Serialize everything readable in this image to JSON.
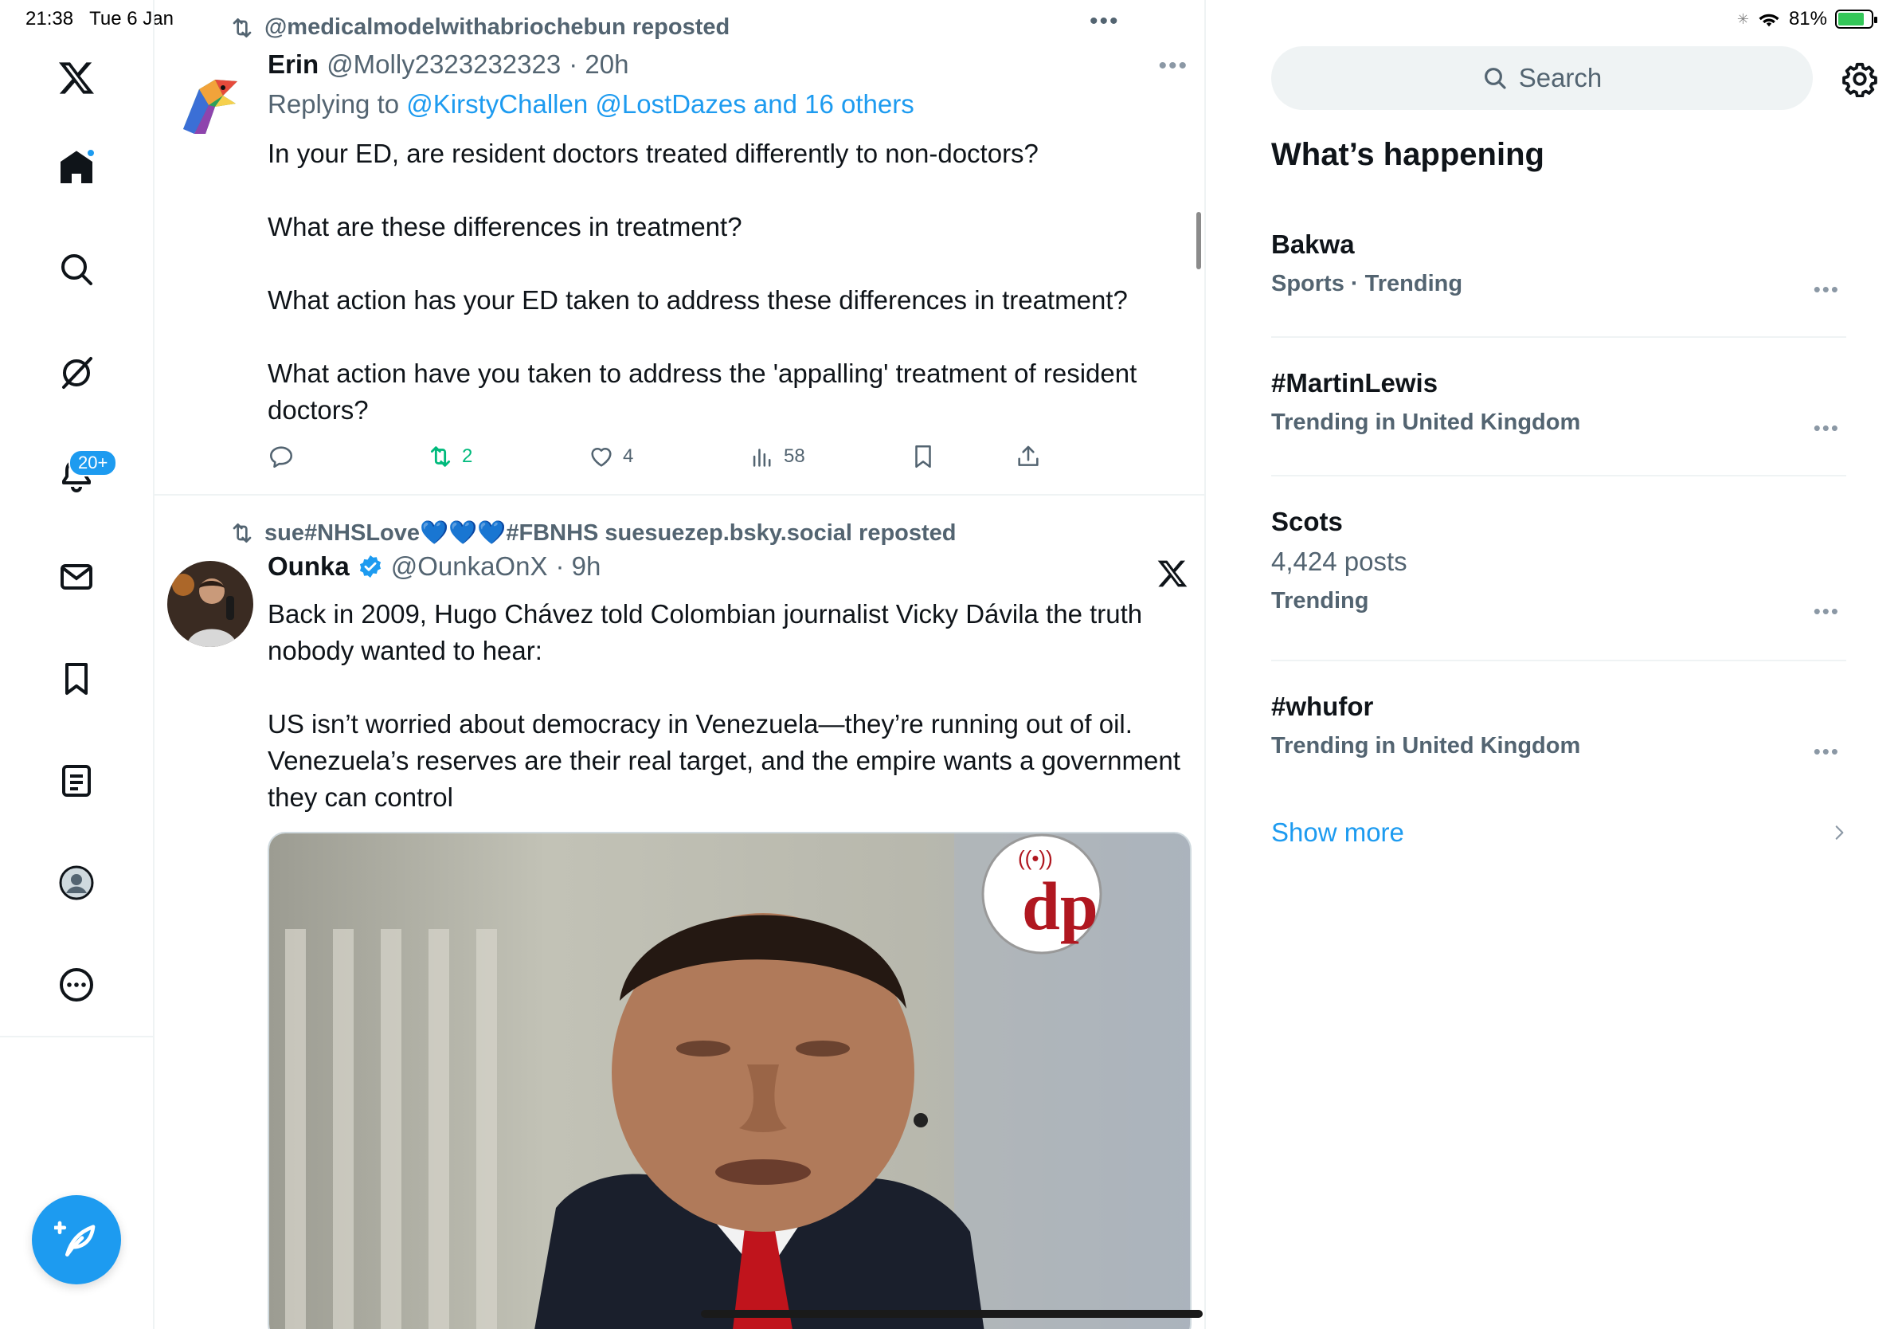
{
  "status_bar": {
    "time": "21:38",
    "date": "Tue 6 Jan",
    "battery": "81%",
    "battery_level": 0.81
  },
  "nav": {
    "notifications_badge": "20+",
    "items": [
      "x-logo",
      "home",
      "explore",
      "grok",
      "notifications",
      "messages",
      "bookmarks",
      "lists",
      "profile",
      "more"
    ]
  },
  "feed": {
    "tweets": [
      {
        "repost_by": "@medicalmodelwithabriochebun reposted",
        "name": "Erin",
        "handle": "@Molly2323232323",
        "time": "· 20h",
        "replying_prefix": "Replying to",
        "replying_to": "@KirstyChallen @LostDazes and 16 others",
        "paragraphs": [
          "In your ED, are resident doctors treated differently to non-doctors?",
          "What are these differences in treatment?",
          "What action has your ED taken to address these differences in treatment?",
          "What action have you taken to address the 'appalling' treatment of resident doctors?"
        ],
        "retweets": "2",
        "likes": "4",
        "views": "58"
      },
      {
        "repost_by": "sue#NHSLove💙💙💙#FBNHS suesuezep.bsky.social reposted",
        "name": "Ounka",
        "handle": "@OunkaOnX",
        "time": "· 9h",
        "paragraphs": [
          "Back in 2009, Hugo Chávez told Colombian journalist Vicky Dávila the truth nobody wanted to hear:",
          "US isn’t worried about democracy in Venezuela—they’re running out of oil. Venezuela’s reserves are their real target, and the empire wants a government they can control"
        ]
      }
    ]
  },
  "sidebar": {
    "search_placeholder": "Search",
    "section_title": "What’s happening",
    "trends": [
      {
        "name": "Bakwa",
        "meta": "Sports · Trending",
        "count": ""
      },
      {
        "name": "#MartinLewis",
        "meta": "Trending in United Kingdom",
        "count": ""
      },
      {
        "name": "Scots",
        "meta": "Trending",
        "count": "4,424 posts"
      },
      {
        "name": "#whufor",
        "meta": "Trending in United Kingdom",
        "count": ""
      }
    ],
    "show_more": "Show more"
  },
  "colors": {
    "accent": "#1d9bf0",
    "text": "#0f1419",
    "muted": "#536471",
    "repost_green": "#00ba7c"
  }
}
